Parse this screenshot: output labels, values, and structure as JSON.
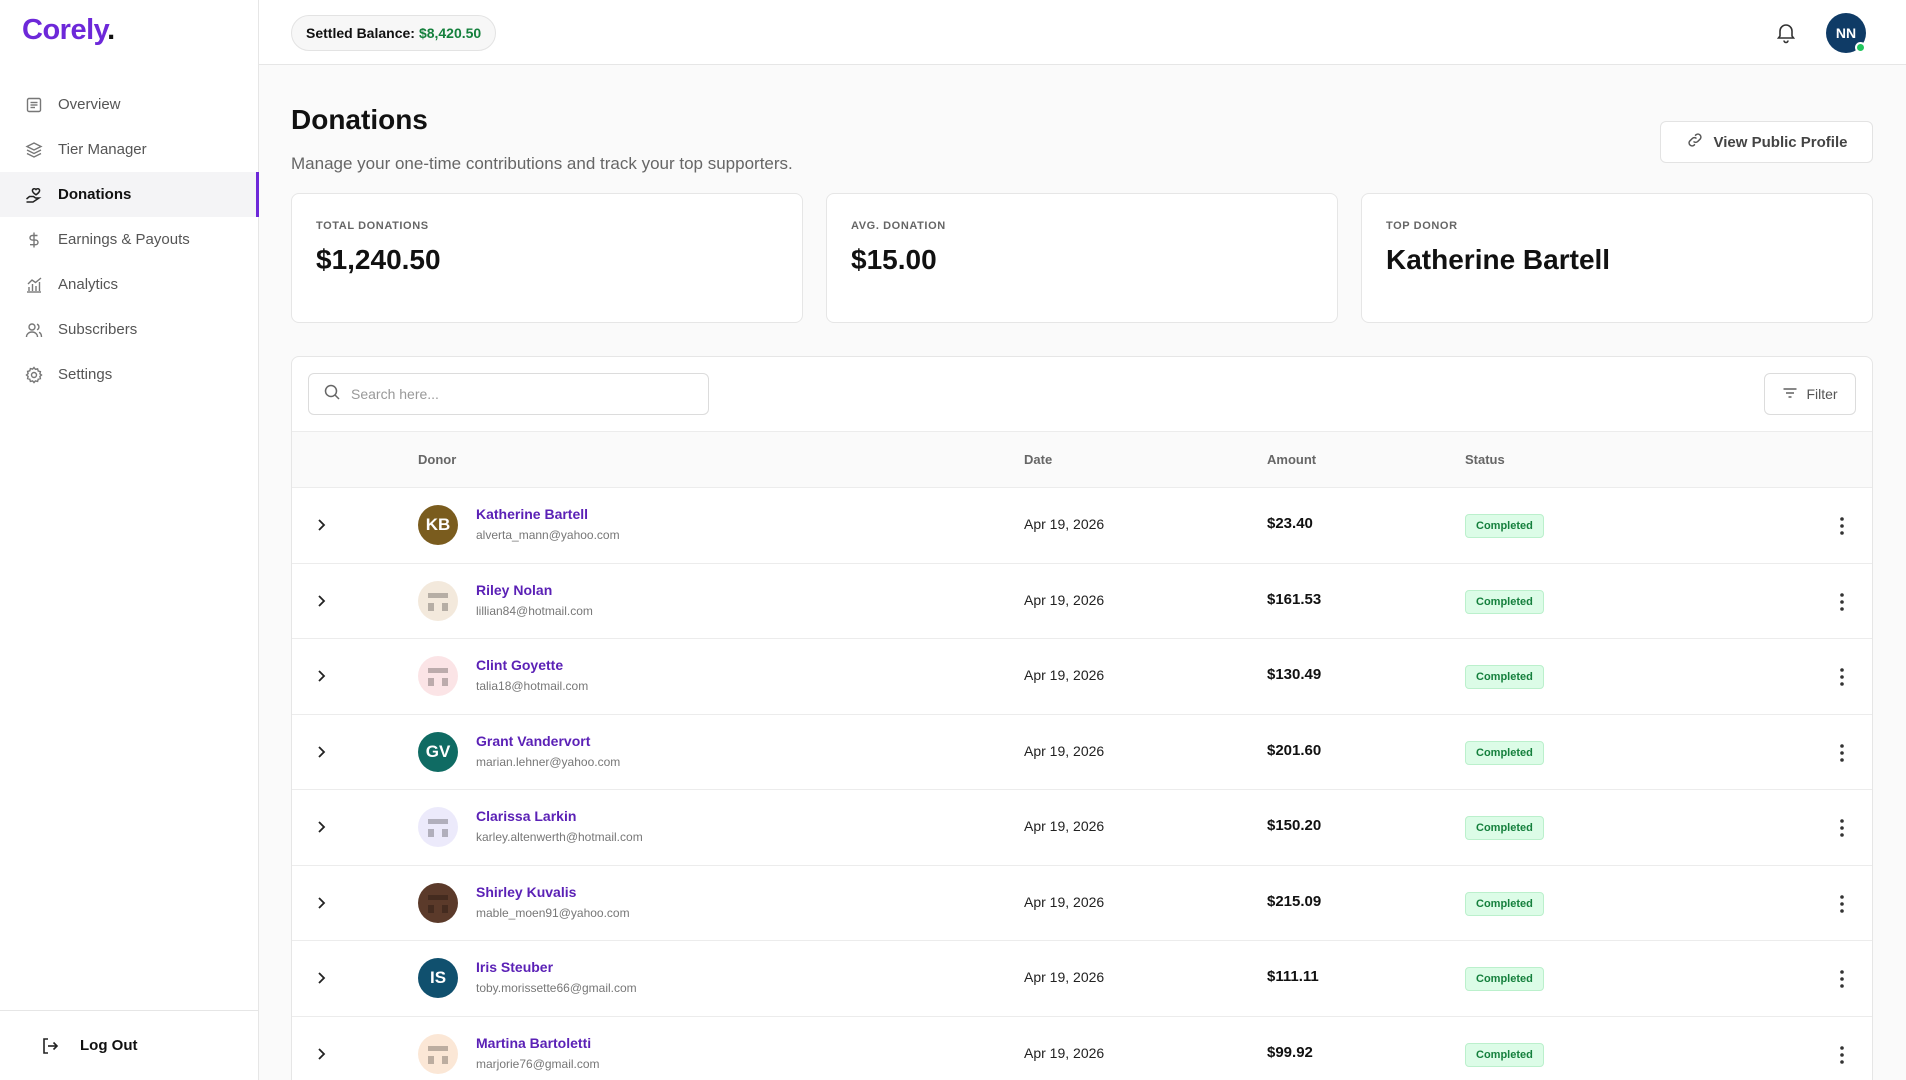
{
  "brand": {
    "name": "Corely",
    "dot": "."
  },
  "sidebar": {
    "items": [
      {
        "label": "Overview",
        "icon": "document-icon",
        "active": false
      },
      {
        "label": "Tier Manager",
        "icon": "layers-icon",
        "active": false
      },
      {
        "label": "Donations",
        "icon": "hand-heart-icon",
        "active": true
      },
      {
        "label": "Earnings & Payouts",
        "icon": "dollar-icon",
        "active": false
      },
      {
        "label": "Analytics",
        "icon": "chart-icon",
        "active": false
      },
      {
        "label": "Subscribers",
        "icon": "users-icon",
        "active": false
      },
      {
        "label": "Settings",
        "icon": "gear-icon",
        "active": false
      }
    ],
    "logout": "Log Out"
  },
  "topbar": {
    "balance_label": "Settled Balance:",
    "balance_value": "$8,420.50",
    "user_initials": "NN"
  },
  "page": {
    "title": "Donations",
    "subtitle": "Manage your one-time contributions and track your top supporters.",
    "public_profile_label": "View Public Profile"
  },
  "stats": [
    {
      "label": "TOTAL DONATIONS",
      "value": "$1,240.50"
    },
    {
      "label": "AVG. DONATION",
      "value": "$15.00"
    },
    {
      "label": "TOP DONOR",
      "value": "Katherine Bartell"
    }
  ],
  "table": {
    "search_placeholder": "Search here...",
    "filter_label": "Filter",
    "columns": {
      "donor": "Donor",
      "date": "Date",
      "amount": "Amount",
      "status": "Status"
    },
    "rows": [
      {
        "name": "Katherine Bartell",
        "email": "alverta_mann@yahoo.com",
        "date": "Apr 19, 2026",
        "amount": "$23.40",
        "status": "Completed",
        "initials": "KB",
        "avatar_color": "#7a5c1e"
      },
      {
        "name": "Riley Nolan",
        "email": "lillian84@hotmail.com",
        "date": "Apr 19, 2026",
        "amount": "$161.53",
        "status": "Completed",
        "initials": "",
        "avatar_color": "#f3e9dc"
      },
      {
        "name": "Clint Goyette",
        "email": "talia18@hotmail.com",
        "date": "Apr 19, 2026",
        "amount": "$130.49",
        "status": "Completed",
        "initials": "",
        "avatar_color": "#fbe4e6"
      },
      {
        "name": "Grant Vandervort",
        "email": "marian.lehner@yahoo.com",
        "date": "Apr 19, 2026",
        "amount": "$201.60",
        "status": "Completed",
        "initials": "GV",
        "avatar_color": "#0f6b63"
      },
      {
        "name": "Clarissa Larkin",
        "email": "karley.altenwerth@hotmail.com",
        "date": "Apr 19, 2026",
        "amount": "$150.20",
        "status": "Completed",
        "initials": "",
        "avatar_color": "#eceafb"
      },
      {
        "name": "Shirley Kuvalis",
        "email": "mable_moen91@yahoo.com",
        "date": "Apr 19, 2026",
        "amount": "$215.09",
        "status": "Completed",
        "initials": "",
        "avatar_color": "#5b3a2a"
      },
      {
        "name": "Iris Steuber",
        "email": "toby.morissette66@gmail.com",
        "date": "Apr 19, 2026",
        "amount": "$111.11",
        "status": "Completed",
        "initials": "IS",
        "avatar_color": "#10506e"
      },
      {
        "name": "Martina Bartoletti",
        "email": "marjorie76@gmail.com",
        "date": "Apr 19, 2026",
        "amount": "$99.92",
        "status": "Completed",
        "initials": "",
        "avatar_color": "#fbe7d6"
      }
    ]
  }
}
